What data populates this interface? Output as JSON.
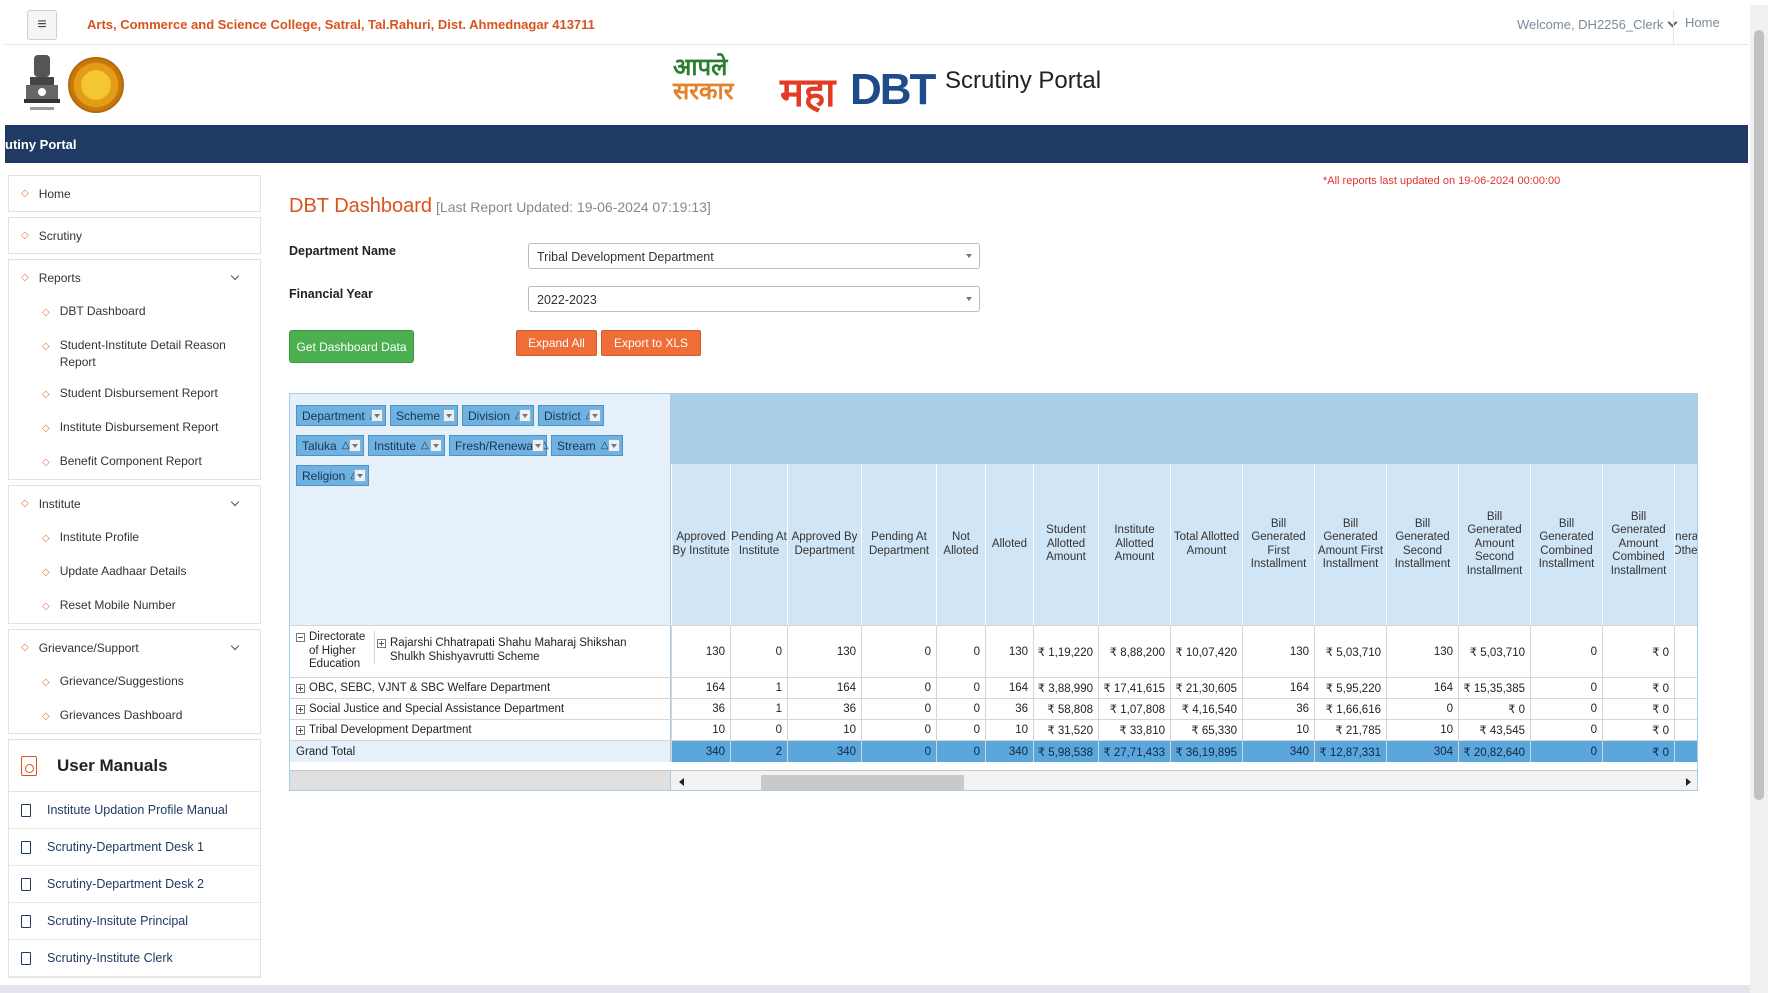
{
  "header": {
    "menu_icon": "≡",
    "college": "Arts, Commerce and Science College, Satral, Tal.Rahuri, Dist. Ahmednagar 413711",
    "welcome": "Welcome, DH2256_Clerk",
    "home": "Home"
  },
  "branding": {
    "apale_line1": "आपले",
    "apale_line2": "सरकार",
    "maha": "महा",
    "dbt": "DBT",
    "portal_title": "Scrutiny Portal",
    "band_text": "utiny Portal"
  },
  "sidebar": {
    "home": "Home",
    "scrutiny": "Scrutiny",
    "reports": {
      "label": "Reports",
      "items": [
        "DBT Dashboard",
        "Student-Institute Detail Reason Report",
        "Student Disbursement Report",
        "Institute Disbursement Report",
        "Benefit Component Report"
      ]
    },
    "institute": {
      "label": "Institute",
      "items": [
        "Institute Profile",
        "Update Aadhaar Details",
        "Reset Mobile Number"
      ]
    },
    "grievance": {
      "label": "Grievance/Support",
      "items": [
        "Grievance/Suggestions",
        "Grievances Dashboard"
      ]
    },
    "manuals": {
      "title": "User Manuals",
      "items": [
        "Institute Updation Profile Manual",
        "Scrutiny-Department Desk 1",
        "Scrutiny-Department Desk 2",
        "Scrutiny-Insitute Principal",
        "Scrutiny-Institute Clerk"
      ]
    }
  },
  "main": {
    "updated_note": "*All reports last updated on 19-06-2024 00:00:00",
    "title": "DBT Dashboard",
    "subtitle": "[Last Report Updated: 19-06-2024 07:19:13]",
    "department_label": "Department Name",
    "department_value": "Tribal Development Department",
    "year_label": "Financial Year",
    "year_value": "2022-2023",
    "get_data_btn": "Get Dashboard Data",
    "expand_btn": "Expand All",
    "export_btn": "Export to XLS"
  },
  "pivot": {
    "filters": [
      "Department",
      "Scheme",
      "Division",
      "District",
      "Taluka",
      "Institute",
      "Fresh/Renewal",
      "Stream",
      "Religion"
    ],
    "filter_sort_icon": "△",
    "columns": [
      "Approved By Institute",
      "Pending At Institute",
      "Approved By Department",
      "Pending At Department",
      "Not Alloted",
      "Alloted",
      "Student Allotted Amount",
      "Institute Allotted Amount",
      "Total Allotted Amount",
      "Bill Generated First Installment",
      "Bill Generated Amount First Installment",
      "Bill Generated Second Installment",
      "Bill Generated Amount Second Installment",
      "Bill Generated Combined Installment",
      "Bill Generated Amount Combined Installment",
      "Generated Other"
    ],
    "rows": [
      {
        "dept": "Directorate of Higher Education",
        "scheme": "Rajarshi Chhatrapati Shahu Maharaj Shikshan Shulkh Shishyavrutti Scheme",
        "values": [
          "130",
          "0",
          "130",
          "0",
          "0",
          "130",
          "₹ 1,19,220",
          "₹ 8,88,200",
          "₹ 10,07,420",
          "130",
          "₹ 5,03,710",
          "130",
          "₹ 5,03,710",
          "0",
          "₹ 0",
          ""
        ]
      },
      {
        "dept": "OBC, SEBC, VJNT & SBC Welfare Department",
        "values": [
          "164",
          "1",
          "164",
          "0",
          "0",
          "164",
          "₹ 3,88,990",
          "₹ 17,41,615",
          "₹ 21,30,605",
          "164",
          "₹ 5,95,220",
          "164",
          "₹ 15,35,385",
          "0",
          "₹ 0",
          ""
        ]
      },
      {
        "dept": "Social Justice and Special Assistance Department",
        "values": [
          "36",
          "1",
          "36",
          "0",
          "0",
          "36",
          "₹ 58,808",
          "₹ 1,07,808",
          "₹ 4,16,540",
          "36",
          "₹ 1,66,616",
          "0",
          "₹ 0",
          "0",
          "₹ 0",
          ""
        ]
      },
      {
        "dept": "Tribal Development Department",
        "values": [
          "10",
          "0",
          "10",
          "0",
          "0",
          "10",
          "₹ 31,520",
          "₹ 33,810",
          "₹ 65,330",
          "10",
          "₹ 21,785",
          "10",
          "₹ 43,545",
          "0",
          "₹ 0",
          ""
        ]
      }
    ],
    "grand_total": {
      "label": "Grand Total",
      "values": [
        "340",
        "2",
        "340",
        "0",
        "0",
        "340",
        "₹ 5,98,538",
        "₹ 27,71,433",
        "₹ 36,19,895",
        "340",
        "₹ 12,87,331",
        "304",
        "₹ 20,82,640",
        "0",
        "₹ 0",
        ""
      ]
    }
  },
  "colors": {
    "accent": "#d9531e",
    "navy": "#1f3b63",
    "green": "#4cb050",
    "orange": "#ef6e38",
    "pivot_blue": "#5aa6dd"
  }
}
